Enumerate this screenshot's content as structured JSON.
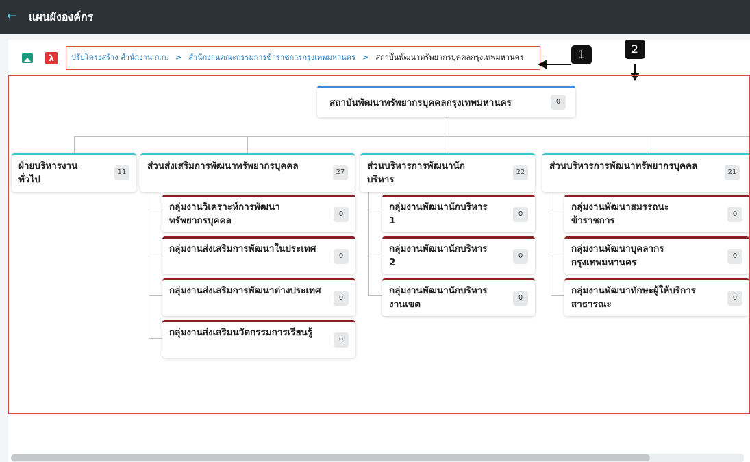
{
  "header": {
    "back_icon": "arrow-left-icon",
    "title": "แผนผังองค์กร"
  },
  "toolbar": {
    "image_icon": "image-icon",
    "pdf_icon": "pdf-icon"
  },
  "breadcrumb": {
    "items": [
      "ปรับโครงสร้าง สำนักงาน ก.ก.",
      "สำนักงานคณะกรรมการข้าราชการกรุงเทพมหานคร"
    ],
    "current": "สถาบันพัฒนาทรัพยากรบุคคลกรุงเทพมหานคร",
    "separator": ">"
  },
  "annotations": {
    "callout_1": "1",
    "callout_2": "2"
  },
  "org": {
    "root": {
      "name": "สถาบันพัฒนาทรัพยากรบุคคลกรุงเทพมหานคร",
      "count": "0"
    },
    "departments": [
      {
        "name": "ฝ่ายบริหารงานทั่วไป",
        "count": "11",
        "groups": []
      },
      {
        "name": "ส่วนส่งเสริมการพัฒนาทรัพยากรบุคคล",
        "count": "27",
        "groups": [
          {
            "name": "กลุ่มงานวิเคราะห์การพัฒนาทรัพยากรบุคคล",
            "count": "0"
          },
          {
            "name": "กลุ่มงานส่งเสริมการพัฒนาในประเทศ",
            "count": "0"
          },
          {
            "name": "กลุ่มงานส่งเสริมการพัฒนาต่างประเทศ",
            "count": "0"
          },
          {
            "name": "กลุ่มงานส่งเสริมนวัตกรรมการเรียนรู้",
            "count": "0"
          }
        ]
      },
      {
        "name": "ส่วนบริหารการพัฒนานักบริหาร",
        "count": "22",
        "groups": [
          {
            "name": "กลุ่มงานพัฒนานักบริหาร 1",
            "count": "0"
          },
          {
            "name": "กลุ่มงานพัฒนานักบริหาร 2",
            "count": "0"
          },
          {
            "name": "กลุ่มงานพัฒนานักบริหารงานเขต",
            "count": "0"
          }
        ]
      },
      {
        "name": "ส่วนบริหารการพัฒนาทรัพยากรบุคคล",
        "count": "21",
        "groups": [
          {
            "name": "กลุ่มงานพัฒนาสมรรถนะข้าราชการ",
            "count": "0"
          },
          {
            "name": "กลุ่มงานพัฒนาบุคลากรกรุงเทพมหานคร",
            "count": "0"
          },
          {
            "name": "กลุ่มงานพัฒนาทักษะผู้ให้บริการสาธารณะ",
            "count": "0"
          }
        ]
      }
    ]
  },
  "colors": {
    "header_bg": "#2d3236",
    "accent": "#3ec4cf",
    "root_accent": "#3a8de0",
    "group_accent": "#8b1f24",
    "highlight": "#e04848",
    "link": "#2f7fc1"
  }
}
